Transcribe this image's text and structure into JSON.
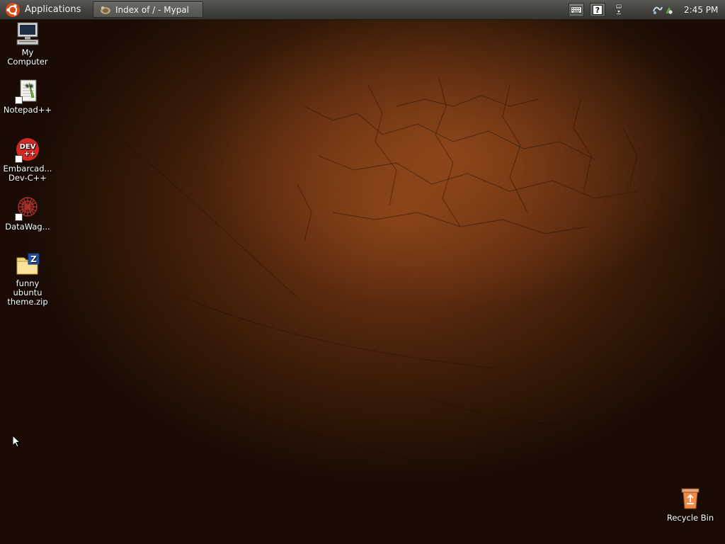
{
  "panel": {
    "applications_label": "Applications",
    "taskbar_window_title": "Index of / - Mypal",
    "clock": "2:45 PM",
    "icons": {
      "app_menu": "ubuntu-logo-icon",
      "window": "browser-window-icon",
      "keyboard": "keyboard-icon",
      "help": "help-icon",
      "network": "network-icon",
      "volume": "volume-icon",
      "update": "update-icon"
    }
  },
  "desktop": {
    "icons": [
      {
        "label": "My\nComputer",
        "icon": "computer-icon"
      },
      {
        "label": "Notepad++",
        "icon": "notepad-plus-plus-icon"
      },
      {
        "label": "Embarcad...\nDev-C++",
        "icon": "dev-cpp-icon"
      },
      {
        "label": "DataWag...",
        "icon": "datawagon-icon"
      },
      {
        "label": "funny\nubuntu\ntheme.zip",
        "icon": "zip-archive-icon"
      },
      {
        "label": "Recycle Bin",
        "icon": "recycle-bin-icon"
      }
    ],
    "dev_icon_text": "DEV",
    "dev_icon_subtext": "++",
    "zip_letter": "Z",
    "help_glyph": "?"
  },
  "colors": {
    "panel": "#44433f",
    "wallpaper_center": "#7a3b15",
    "wallpaper_edge": "#1a0c04",
    "ubuntu_orange": "#dd4814"
  }
}
